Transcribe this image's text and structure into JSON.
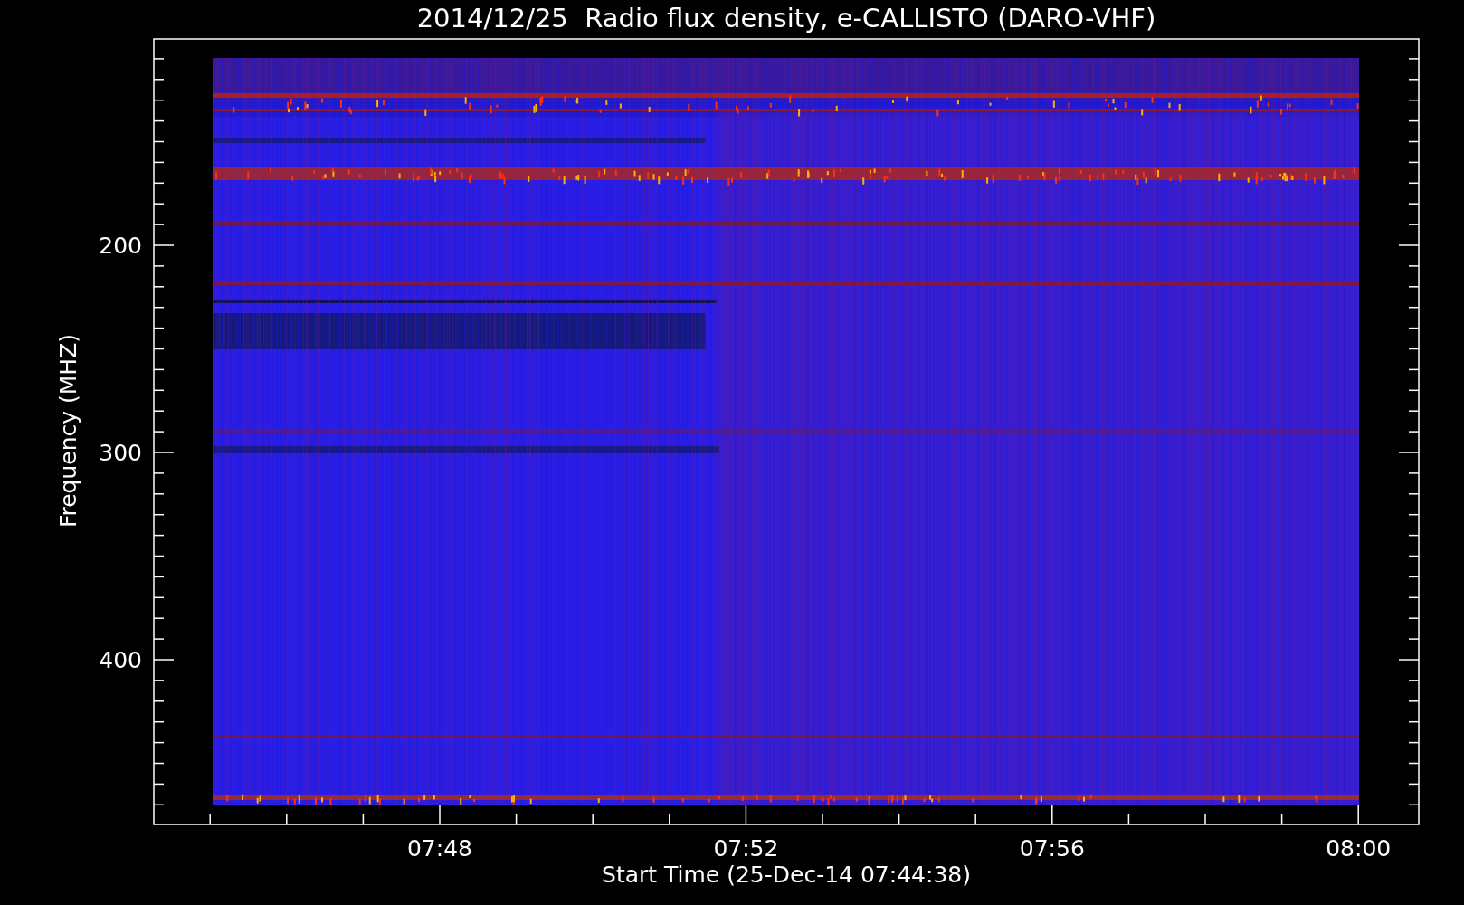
{
  "title": "2014/12/25  Radio flux density, e-CALLISTO (DARO-VHF)",
  "y_axis": {
    "label": "Frequency (MHZ)",
    "ticks": [
      "200",
      "300",
      "400"
    ]
  },
  "x_axis": {
    "label": "Start Time (25-Dec-14 07:44:38)",
    "ticks": [
      "07:48",
      "07:52",
      "07:56",
      "08:00"
    ]
  }
}
